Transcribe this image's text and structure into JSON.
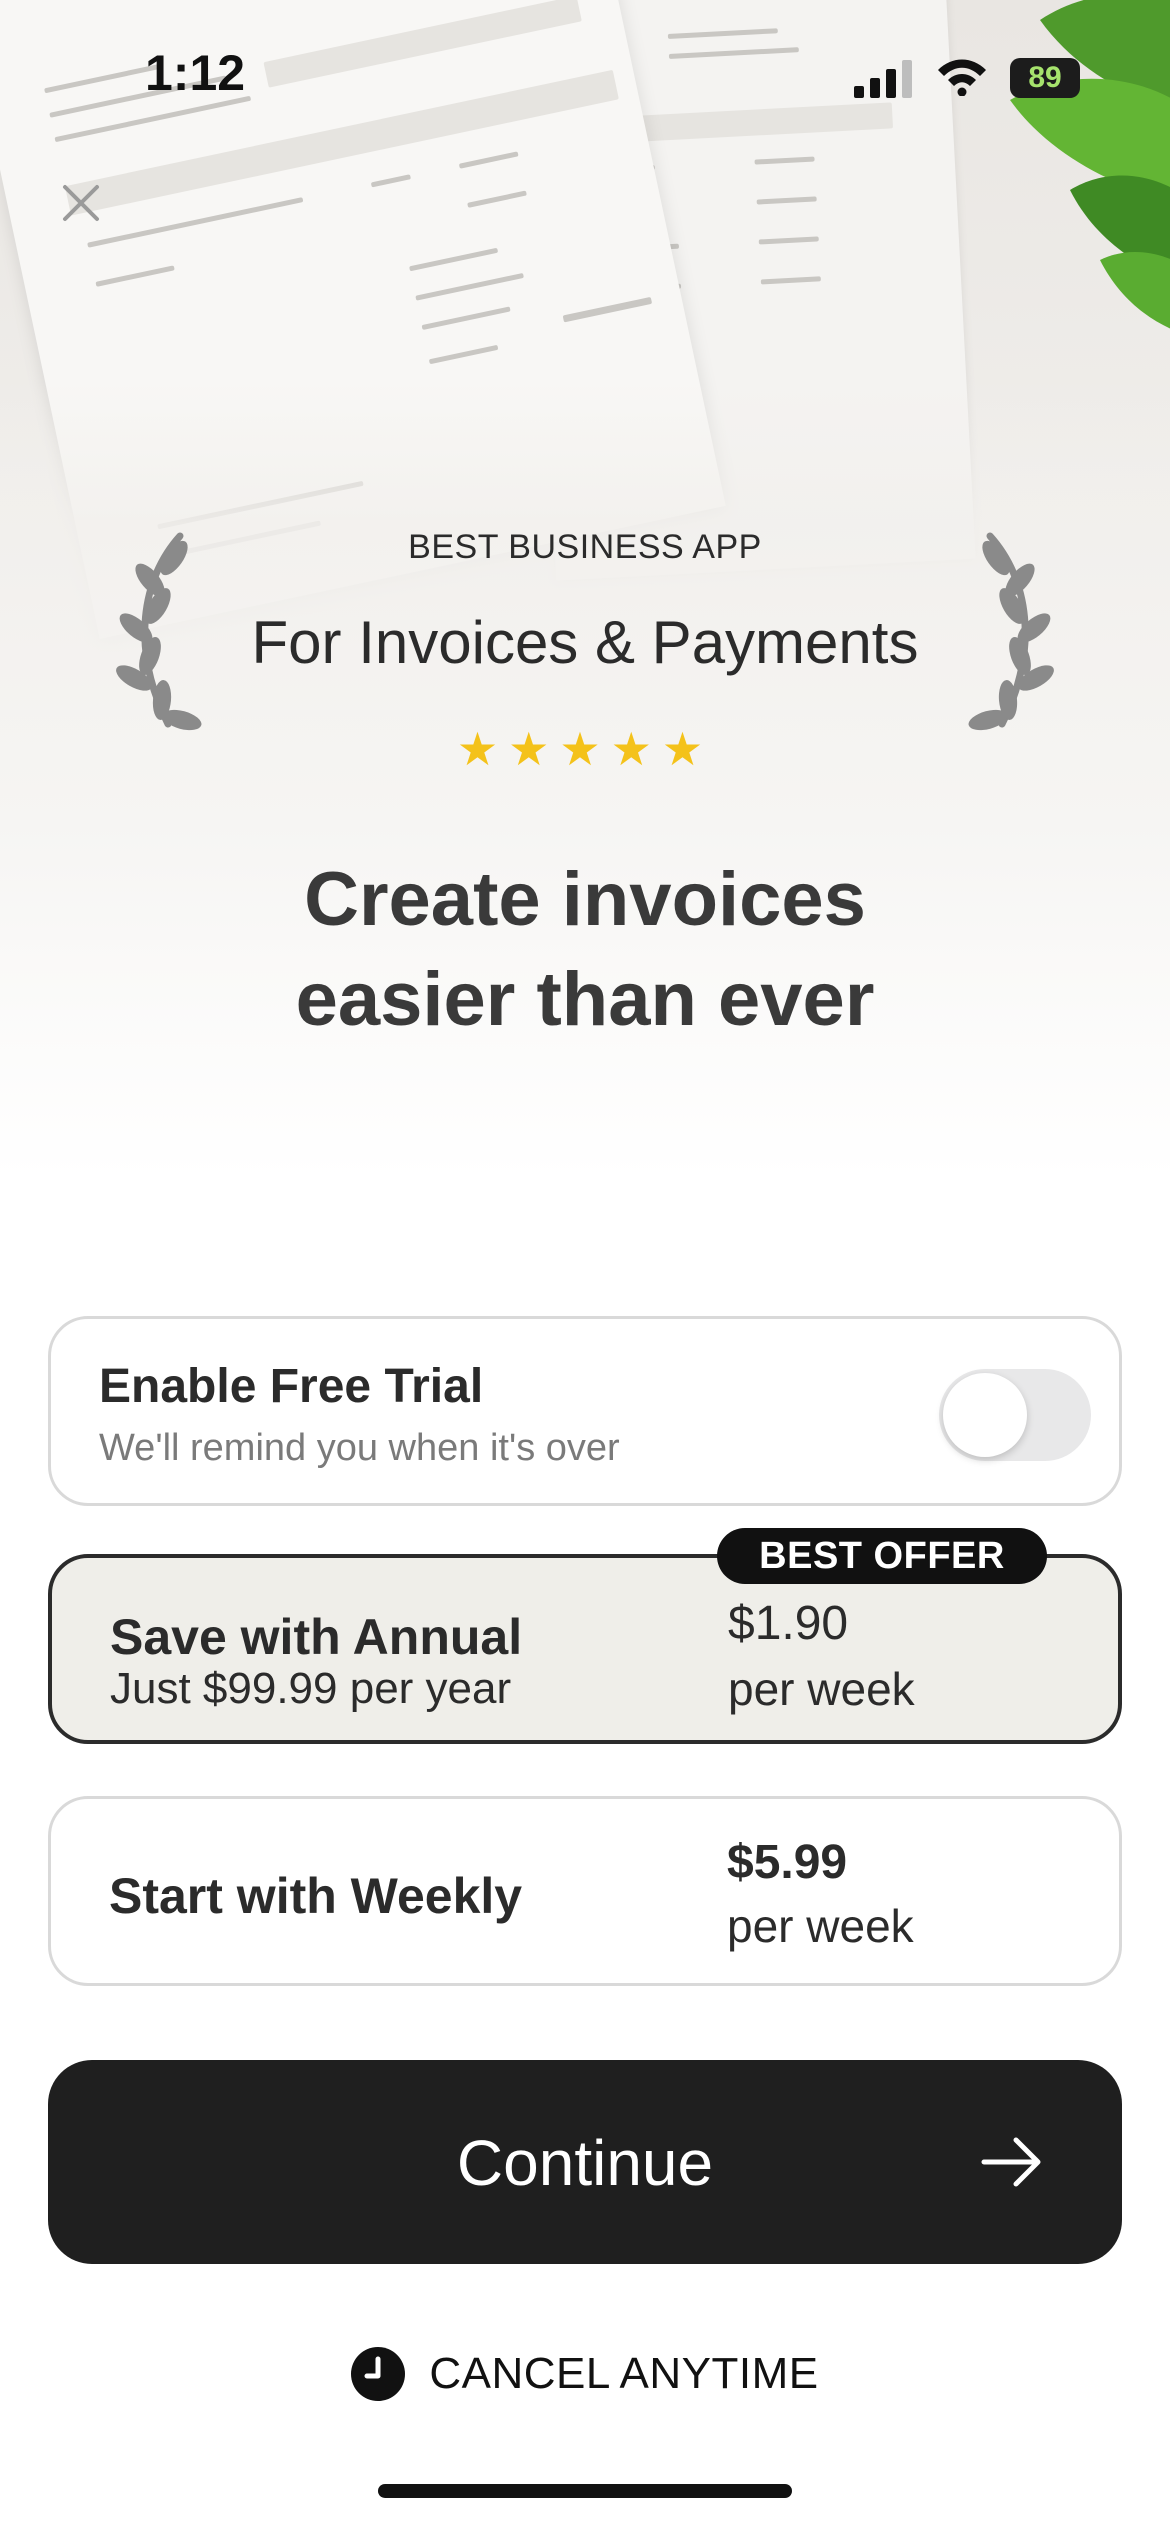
{
  "status_bar": {
    "time": "1:12",
    "battery": "89"
  },
  "award": {
    "kicker": "BEST BUSINESS APP",
    "title": "For Invoices & Payments",
    "stars": "★★★★★",
    "rating": 5
  },
  "headline": {
    "line1": "Create invoices",
    "line2": "easier than ever"
  },
  "trial": {
    "title": "Enable Free Trial",
    "subtitle": "We'll remind you when it's over",
    "enabled": false
  },
  "plans": [
    {
      "name": "Save with Annual",
      "note": "Just $99.99 per year",
      "price": "$1.90",
      "unit": "per week",
      "badge": "BEST OFFER",
      "selected": true
    },
    {
      "name": "Start with Weekly",
      "price": "$5.99",
      "unit": "per week",
      "selected": false
    }
  ],
  "cta": {
    "label": "Continue"
  },
  "footer": {
    "cancel_label": "CANCEL ANYTIME"
  },
  "colors": {
    "accent": "#1f1f1f",
    "star": "#f4c21a",
    "selected_bg": "#efeee9",
    "battery_text": "#a6e36d"
  }
}
